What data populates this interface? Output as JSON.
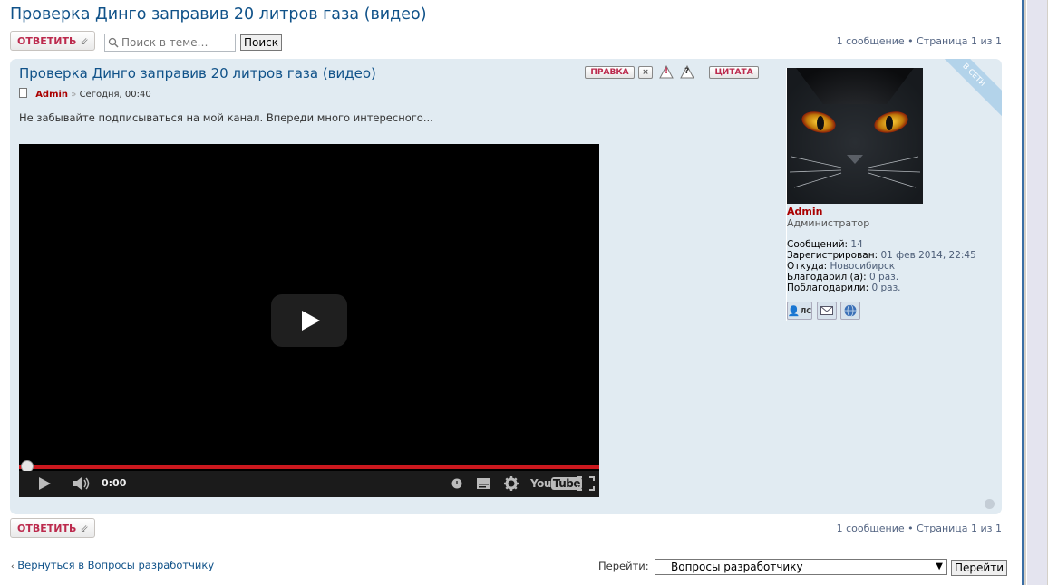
{
  "page": {
    "title": "Проверка Динго заправив 20 литров газа (видео)"
  },
  "toolbar": {
    "reply_label": "ОТВЕТИТЬ",
    "search_placeholder": "Поиск в теме…",
    "search_button": "Поиск",
    "pagination": "1 сообщение • Страница 1 из 1"
  },
  "post": {
    "title": "Проверка Динго заправив 20 литров газа (видео)",
    "author": "Admin",
    "separator": "»",
    "time": "Сегодня, 00:40",
    "text": "Не забывайте подписываться на мой канал. Впереди много интересного...",
    "buttons": {
      "edit": "ПРАВКА",
      "quote": "ЦИТАТА",
      "delete": "×",
      "report": "!",
      "info": "?"
    },
    "video": {
      "time": "0:00",
      "progress": 0,
      "brand": "YouTube"
    }
  },
  "profile": {
    "name": "Admin",
    "rank": "Администратор",
    "online_badge": "В СЕТИ",
    "stats": [
      {
        "label": "Сообщений:",
        "value": "14"
      },
      {
        "label": "Зарегистрирован:",
        "value": "01 фев 2014, 22:45"
      },
      {
        "label": "Откуда:",
        "value": "Новосибирск"
      },
      {
        "label": "Благодарил (а):",
        "value": "0 раз."
      },
      {
        "label": "Поблагодарили:",
        "value": "0 раз."
      }
    ],
    "pm_label": "ЛС"
  },
  "bottom": {
    "reply_label": "ОТВЕТИТЬ",
    "pagination": "1 сообщение • Страница 1 из 1",
    "back_link": "Вернуться в Вопросы разработчику",
    "jump_label": "Перейти:",
    "jump_selected": "Вопросы разработчику",
    "jump_button": "Перейти"
  },
  "colors": {
    "link": "#105289",
    "accent": "#bc2a4d",
    "author": "#aa0000",
    "post_bg": "#e1ebf2",
    "video_progress": "#cc181e"
  }
}
